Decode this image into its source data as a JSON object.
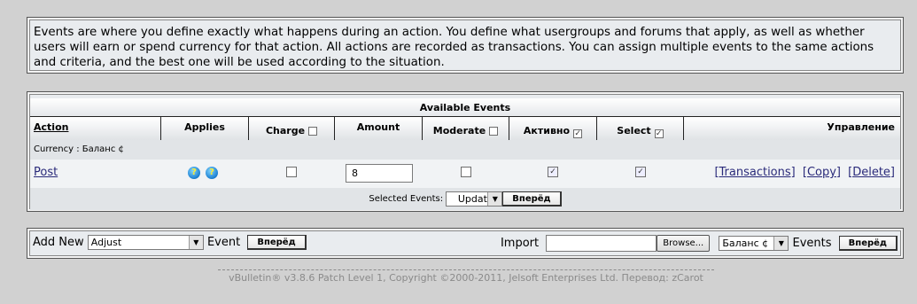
{
  "info_text": "Events are where you define exactly what happens during an action. You define what usergroups and forums that apply, as well as whether users will earn or spend currency for that action. All actions are recorded as transactions. You can assign multiple events to the same actions and criteria, and the best one will be used according to the situation.",
  "events_table": {
    "title": "Available Events",
    "headers": {
      "action": "Action",
      "applies": "Applies",
      "charge": "Charge",
      "amount": "Amount",
      "moderate": "Moderate",
      "active": "Активно",
      "select": "Select",
      "manage": "Управление"
    },
    "header_checks": {
      "charge": false,
      "moderate": false,
      "active": true,
      "select": true
    },
    "currency_label": "Currency : Баланс ¢",
    "rows": [
      {
        "action": "Post",
        "applies_icons": [
          "help-icon",
          "help-icon"
        ],
        "applies_glyph": "?",
        "charge": false,
        "amount": "8",
        "moderate": false,
        "active": true,
        "select": true,
        "links": {
          "transactions": "[Transactions]",
          "copy": "[Copy]",
          "delete": "[Delete]"
        }
      }
    ],
    "footer": {
      "label": "Selected Events:",
      "select_value": "Update",
      "go_button": "Вперёд"
    }
  },
  "add_new": {
    "label": "Add New",
    "select_value": "Adjust",
    "suffix": "Event",
    "go_button": "Вперёд"
  },
  "import": {
    "label": "Import",
    "browse_button": "Browse...",
    "currency_value": "Баланс ¢",
    "suffix": "Events",
    "go_button": "Вперёд"
  },
  "copyright": "vBulletin® v3.8.6 Patch Level 1, Copyright ©2000-2011, Jelsoft Enterprises Ltd. Перевод: zCarot",
  "check_glyph": "✓",
  "dropdown_glyph": "▼",
  "colors": {
    "background": "#d1d1d1",
    "panel": "#e9ecef",
    "link": "#2a2a7a",
    "copyright": "#8a8a8a"
  }
}
